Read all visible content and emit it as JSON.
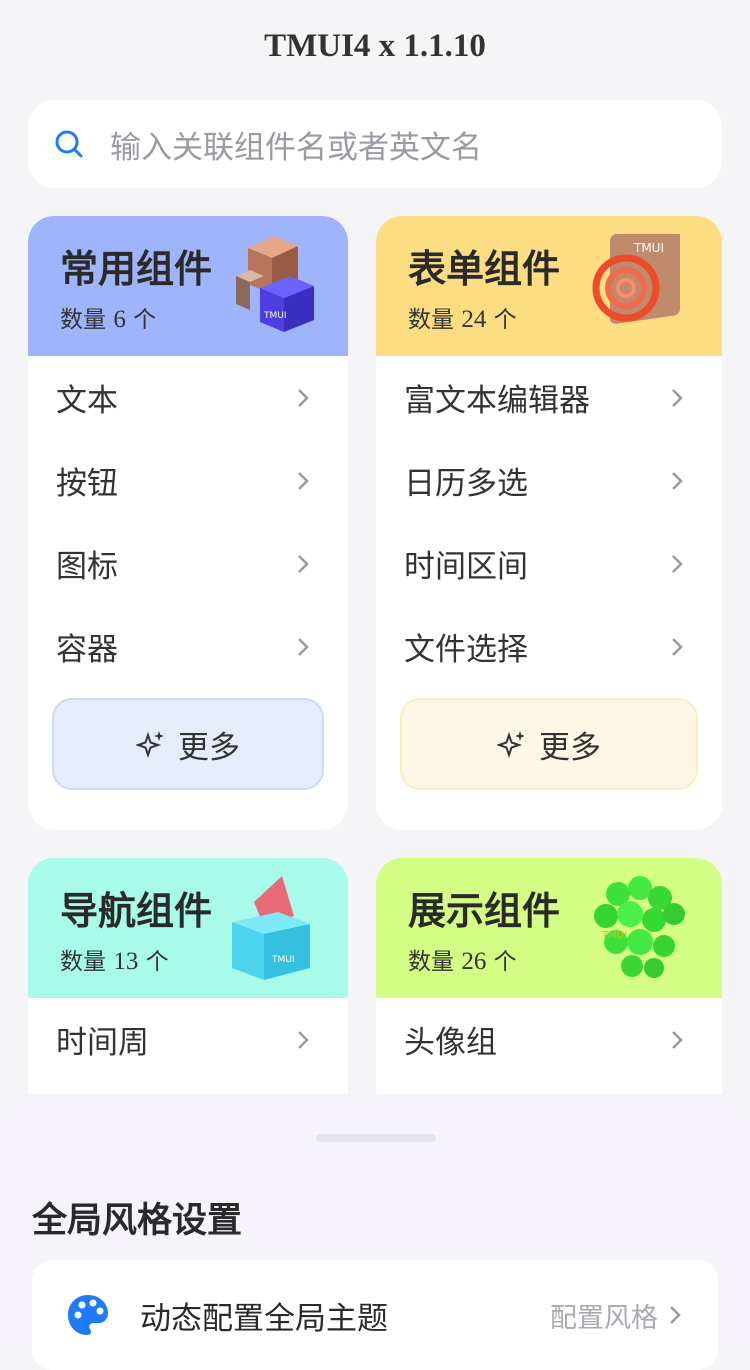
{
  "header": {
    "title": "TMUI4 x 1.1.10"
  },
  "search": {
    "placeholder": "输入关联组件名或者英文名"
  },
  "cards": [
    {
      "title": "常用组件",
      "count_prefix": "数量",
      "count_num": "6",
      "count_suffix": "个",
      "header_color": "#9fb4fb",
      "items": [
        "文本",
        "按钮",
        "图标",
        "容器"
      ],
      "more_label": "更多",
      "more_bg": "#e7ecfd",
      "more_border": "#cfdaf8"
    },
    {
      "title": "表单组件",
      "count_prefix": "数量",
      "count_num": "24",
      "count_suffix": "个",
      "header_color": "#fddd82",
      "items": [
        "富文本编辑器",
        "日历多选",
        "时间区间",
        "文件选择"
      ],
      "more_label": "更多",
      "more_bg": "#fdf7e6",
      "more_border": "#f9edc8"
    },
    {
      "title": "导航组件",
      "count_prefix": "数量",
      "count_num": "13",
      "count_suffix": "个",
      "header_color": "#a8fbe8",
      "items": [
        "时间周"
      ]
    },
    {
      "title": "展示组件",
      "count_prefix": "数量",
      "count_num": "26",
      "count_suffix": "个",
      "header_color": "#d4fd86",
      "items": [
        "头像组"
      ]
    }
  ],
  "sheet": {
    "title": "全局风格设置",
    "row_label": "动态配置全局主题",
    "row_action": "配置风格"
  },
  "icons": {
    "search": "search-icon",
    "chevron": "chevron-right-icon",
    "sparkle": "sparkle-icon",
    "palette": "palette-icon"
  },
  "colors": {
    "accent": "#1f7bf6"
  }
}
